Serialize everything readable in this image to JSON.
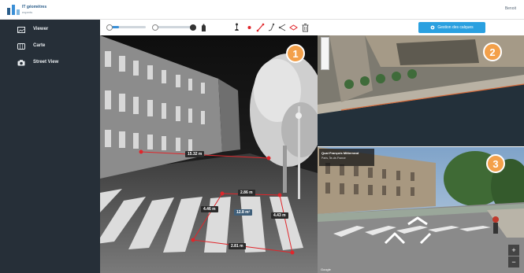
{
  "header": {
    "logo_text": "IT géomètres",
    "logo_sub": "experts",
    "user_label": "Benoit"
  },
  "sidebar": {
    "items": [
      {
        "label": "Viewer",
        "icon": "image-icon"
      },
      {
        "label": "Carte",
        "icon": "map-icon"
      },
      {
        "label": "Street View",
        "icon": "camera-icon"
      }
    ]
  },
  "toolbar": {
    "primary_button": "Gestion des calques",
    "tools": [
      "hand-icon",
      "point-icon",
      "line-icon",
      "polyline-icon",
      "angle-icon",
      "profile-icon",
      "trash-icon"
    ]
  },
  "pointcloud": {
    "badge": "1",
    "measurements": {
      "top_line": "15.32 m",
      "rect_top": "2.86 m",
      "rect_left": "4.46 m",
      "area": "12.8 m²",
      "rect_right": "4.43 m",
      "rect_bottom": "2.81 m"
    }
  },
  "aerial": {
    "badge": "2"
  },
  "streetview": {
    "badge": "3",
    "address_title": "Quai François Mitterrand",
    "address_sub": "Paris, Île-de-France",
    "attribution": "Google",
    "zoom_in": "+",
    "zoom_out": "−"
  },
  "colors": {
    "sidebar_bg": "#262f38",
    "accent": "#2aa0e0",
    "measure_red": "#e0262b",
    "badge_orange": "#f3a04a"
  }
}
